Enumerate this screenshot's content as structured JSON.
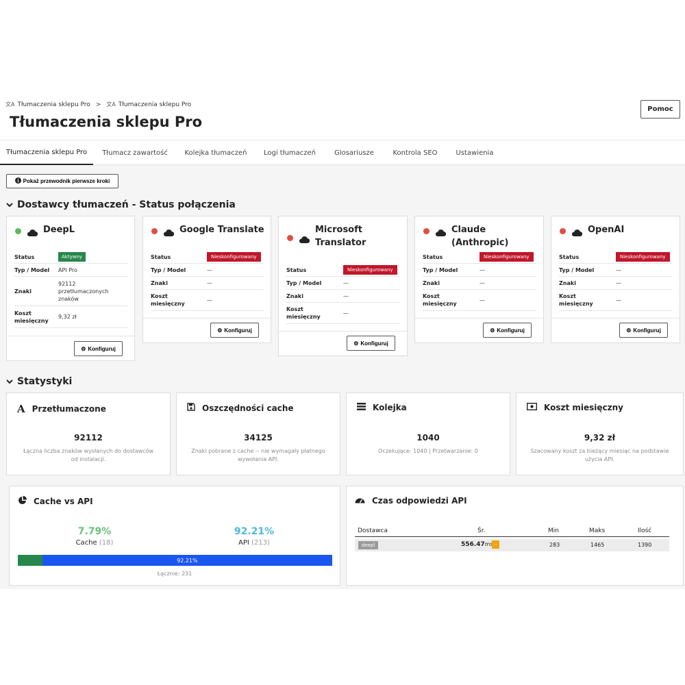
{
  "breadcrumb": [
    "Tłumaczenia sklepu Pro",
    "Tłumaczenia sklepu Pro"
  ],
  "breadcrumb_separator": ">",
  "page_title": "Tłumaczenia sklepu Pro",
  "help_label": "Pomoc",
  "tabs": [
    "Tłumaczenia sklepu Pro",
    "Tłumacz zawartość",
    "Kolejka tłumaczeń",
    "Logi tłumaczeń",
    "Glosariusze",
    "Kontrola SEO",
    "Ustawienia"
  ],
  "guide_button": "Pokaż przewodnik pierwsze kroki",
  "providers_section_title": "Dostawcy tłumaczeń - Status połączenia",
  "provider_labels": {
    "status": "Status",
    "model": "Typ / Model",
    "chars": "Znaki",
    "cost": "Koszt miesięczny"
  },
  "configure_label": "Konfiguruj",
  "providers": [
    {
      "name": "DeepL",
      "status": "Aktywny",
      "model": "API Pro",
      "chars": "92112 przetłumaczonych znaków",
      "cost": "9,32 zł",
      "status_color": "#27864b"
    },
    {
      "name": "Google Translate",
      "status": "Nieskonfigurowany",
      "model": "—",
      "chars": "—",
      "cost": "—",
      "status_color": "#c0172b"
    },
    {
      "name": "Microsoft Translator",
      "status": "Nieskonfigurowany",
      "model": "—",
      "chars": "—",
      "cost": "—",
      "status_color": "#c0172b"
    },
    {
      "name": "Claude (Anthropic)",
      "status": "Nieskonfigurowany",
      "model": "—",
      "chars": "—",
      "cost": "—",
      "status_color": "#c0172b"
    },
    {
      "name": "OpenAI",
      "status": "Nieskonfigurowany",
      "model": "—",
      "chars": "—",
      "cost": "—",
      "status_color": "#c0172b"
    }
  ],
  "stats_section_title": "Statystyki",
  "stats": [
    {
      "title": "Przetłumaczone",
      "value": "92112",
      "desc": "Łączna liczba znaków wysłanych do dostawców od instalacji.",
      "icon": "font-icon"
    },
    {
      "title": "Oszczędności cache",
      "value": "34125",
      "desc": "Znaki pobrane z cache -- nie wymagały płatnego wywołania API.",
      "icon": "save-icon"
    },
    {
      "title": "Kolejka",
      "value": "1040",
      "desc": "Oczekujące: 1040 | Przetwarzanie: 0",
      "icon": "list-icon"
    },
    {
      "title": "Koszt miesięczny",
      "value": "9,32 zł",
      "desc": "Szacowany koszt za bieżący miesiąc na podstawie użycia API.",
      "icon": "money-icon"
    }
  ],
  "cache_vs_api": {
    "title": "Cache vs API",
    "cache_pct": "7.79%",
    "cache_label": "Cache",
    "cache_count": "(18)",
    "api_pct": "92.21%",
    "api_label": "API",
    "api_count": "(213)",
    "bar_cache_fraction": 0.0779,
    "bar_label": "92.21%",
    "total": "Łącznie: 231",
    "colors": {
      "cache": "#27864b",
      "api": "#1a56f0"
    }
  },
  "response_time": {
    "title": "Czas odpowiedzi API",
    "headers": [
      "Dostawca",
      "Śr.",
      "Min",
      "Maks",
      "Ilość"
    ],
    "rows": [
      {
        "provider": "deepl",
        "avg": "556.47",
        "avg_unit": "ms",
        "badge": "--",
        "min": "283",
        "max": "1465",
        "count": "1390"
      }
    ],
    "badge_color": "#f0a30a"
  }
}
